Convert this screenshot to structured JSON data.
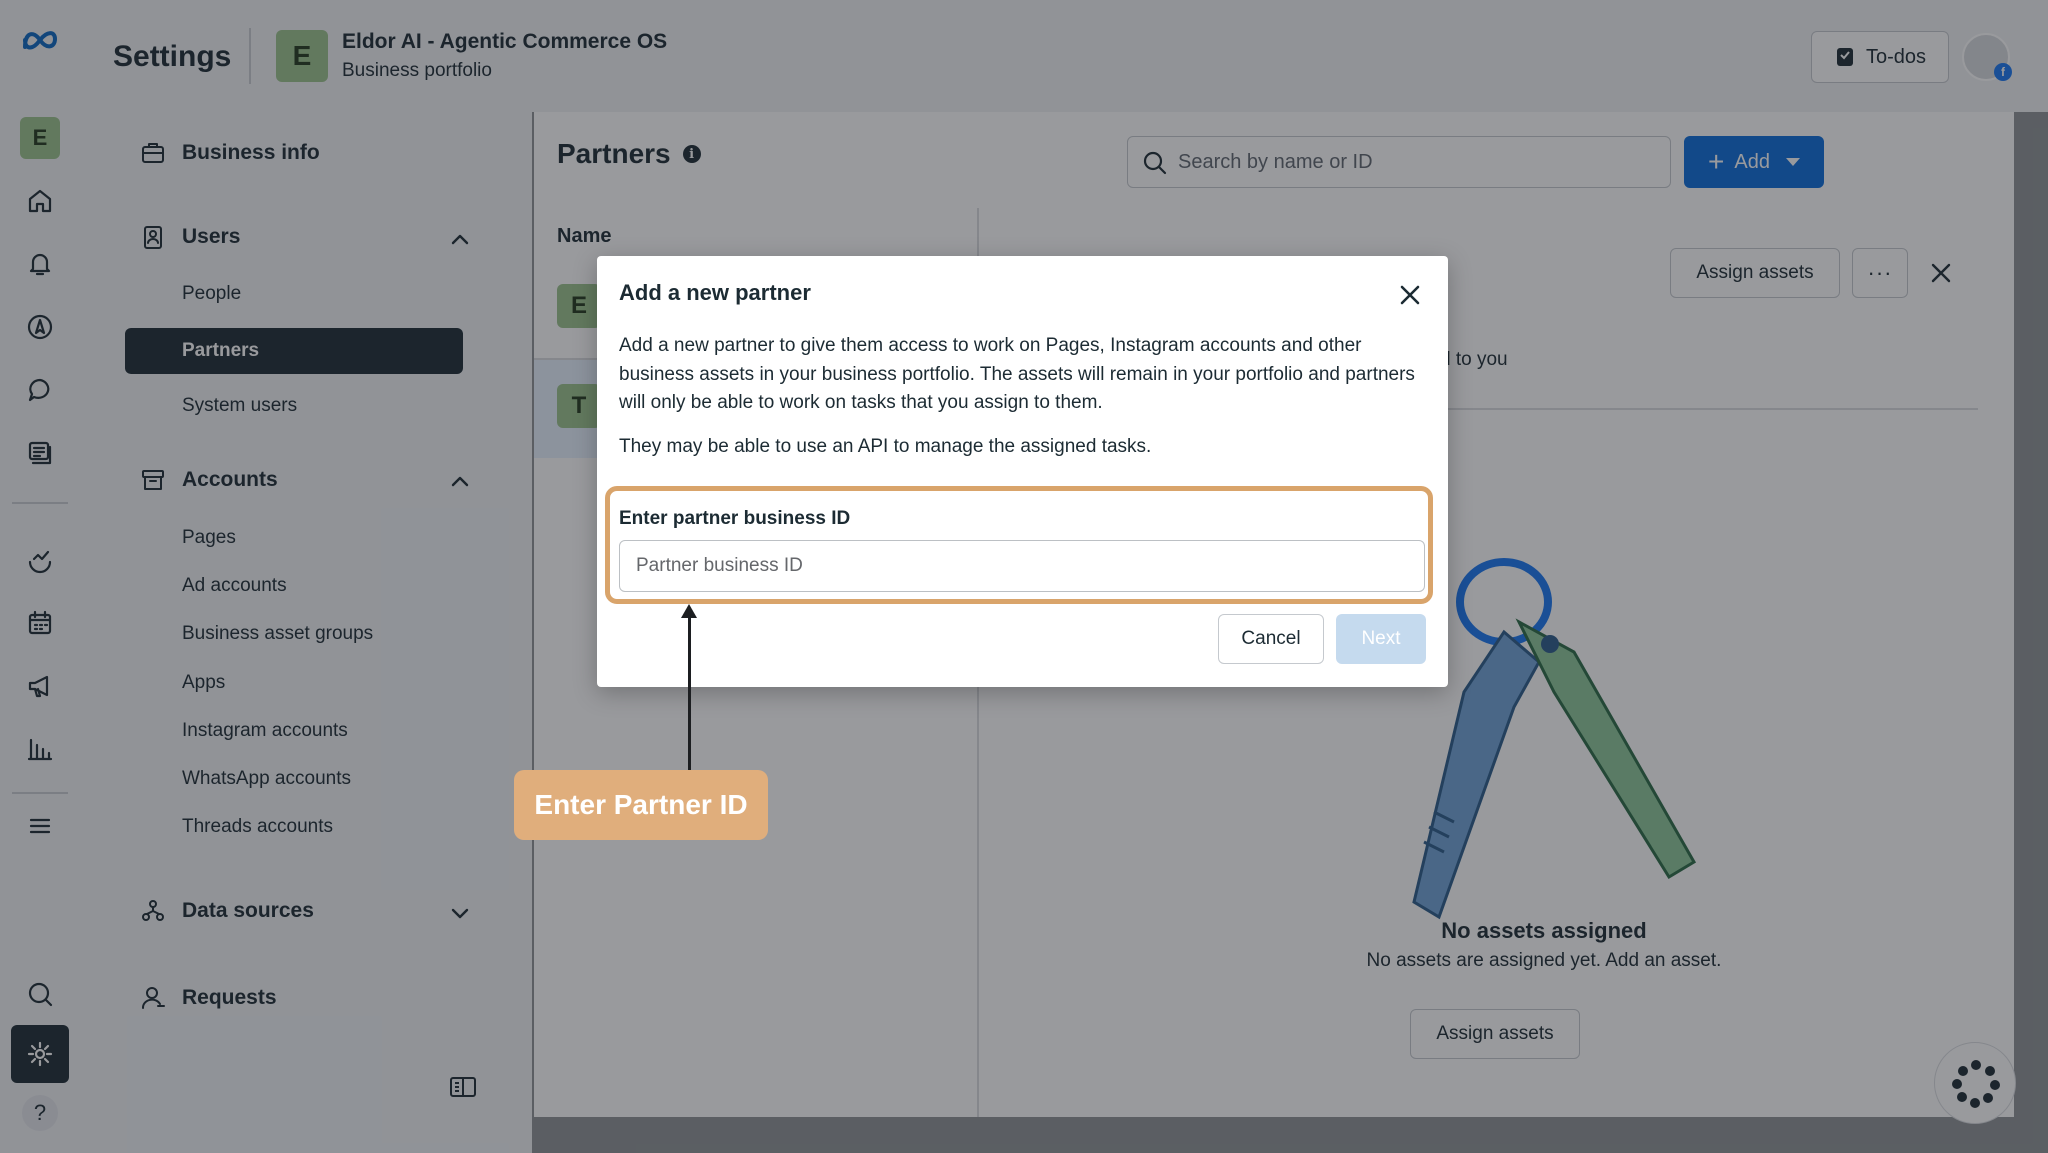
{
  "app": {
    "title": "Settings",
    "business": {
      "avatar_letter": "E",
      "name": "Eldor AI - Agentic Commerce OS",
      "subtitle": "Business portfolio"
    },
    "todos_label": "To-dos"
  },
  "rail": {
    "workspace_letter": "E",
    "icons": [
      "meta-logo-icon",
      "workspace-avatar",
      "home-icon",
      "bell-icon",
      "compass-icon",
      "chat-icon",
      "content-icon",
      "analytics-icon",
      "calendar-icon",
      "megaphone-icon",
      "bar-chart-icon",
      "menu-icon",
      "search-icon",
      "gear-icon",
      "help-icon"
    ],
    "help_glyph": "?"
  },
  "nav": {
    "business_info": "Business info",
    "users": {
      "label": "Users",
      "items": [
        "People",
        "Partners",
        "System users"
      ],
      "active": "Partners"
    },
    "accounts": {
      "label": "Accounts",
      "items": [
        "Pages",
        "Ad accounts",
        "Business asset groups",
        "Apps",
        "Instagram accounts",
        "WhatsApp accounts",
        "Threads accounts"
      ]
    },
    "data_sources": "Data sources",
    "requests": "Requests"
  },
  "panel": {
    "title": "Partners",
    "search_placeholder": "Search by name or ID",
    "add_label": "Add",
    "column_name": "Name",
    "rows": [
      {
        "avatar_letter": "E"
      },
      {
        "avatar_letter": "T"
      }
    ],
    "detail": {
      "assign_label": "Assign assets",
      "more_glyph": "···",
      "fragment_text": "d to you",
      "empty_title": "No assets assigned",
      "empty_subtitle": "No assets are assigned yet. Add an asset.",
      "assign_bottom_label": "Assign assets"
    }
  },
  "modal": {
    "title": "Add a new partner",
    "paragraph1": "Add a new partner to give them access to work on Pages, Instagram accounts and other business assets in your business portfolio. The assets will remain in your portfolio and partners will only be able to work on tasks that you assign to them.",
    "paragraph2": "They may be able to use an API to manage the assigned tasks.",
    "field_label": "Enter partner business ID",
    "field_placeholder": "Partner business ID",
    "field_value": "",
    "cancel_label": "Cancel",
    "next_label": "Next"
  },
  "annotation": {
    "callout_text": "Enter Partner ID",
    "highlight_color": "#d9a46b"
  },
  "colors": {
    "accent": "#0a6cda",
    "dark": "#1c2b33",
    "callout": "#e0ae7c",
    "next_disabled": "#c5daee"
  }
}
